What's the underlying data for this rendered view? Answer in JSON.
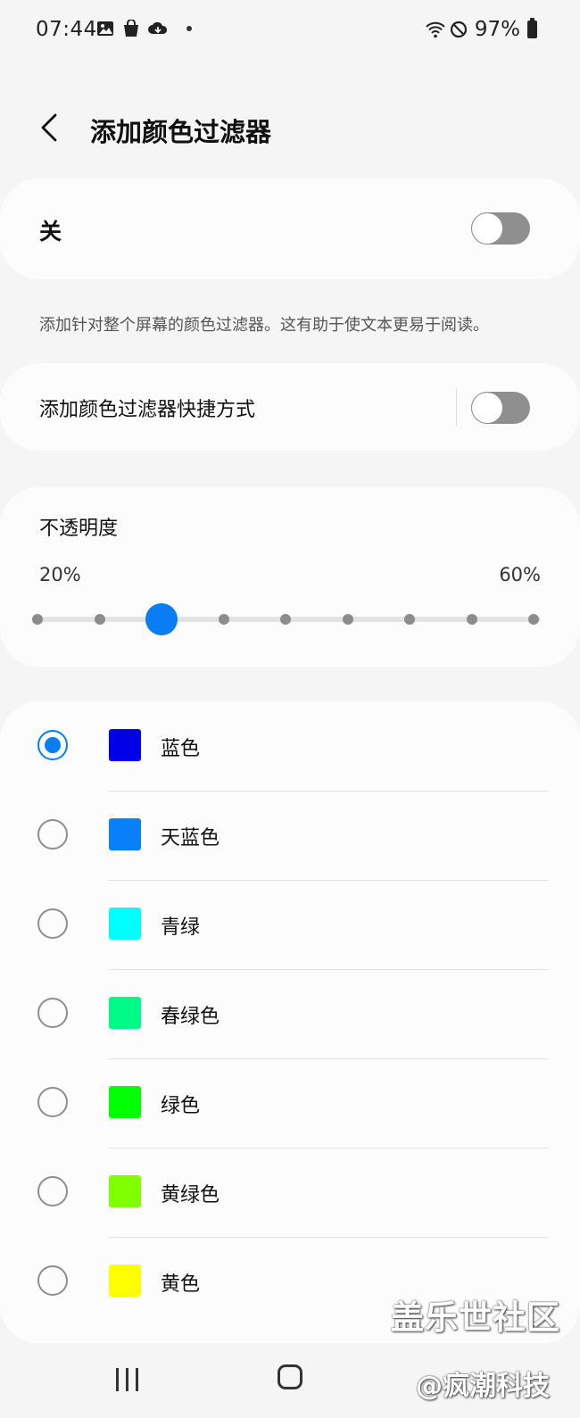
{
  "status_bar": {
    "time": "07:44",
    "battery": "97%",
    "left_icons": [
      "gallery-icon",
      "shopping-bag-icon",
      "cloud-sync-icon",
      "notification-dot"
    ],
    "right_icons": [
      "wifi-icon",
      "do-not-disturb-icon",
      "battery-icon"
    ]
  },
  "header": {
    "title": "添加颜色过滤器",
    "back_icon": "chevron-left-icon"
  },
  "master_toggle": {
    "label": "关",
    "enabled": false
  },
  "description": "添加针对整个屏幕的颜色过滤器。这有助于使文本更易于阅读。",
  "shortcut": {
    "label": "添加颜色过滤器快捷方式",
    "enabled": false
  },
  "opacity": {
    "label": "不透明度",
    "min_label": "20%",
    "max_label": "60%",
    "steps": 9,
    "selected_step": 2
  },
  "colors": [
    {
      "name": "蓝色",
      "swatch": "#0000e6",
      "selected": true
    },
    {
      "name": "天蓝色",
      "swatch": "#0a80f8",
      "selected": false
    },
    {
      "name": "青绿",
      "swatch": "#00ffff",
      "selected": false
    },
    {
      "name": "春绿色",
      "swatch": "#00fa87",
      "selected": false
    },
    {
      "name": "绿色",
      "swatch": "#00ff00",
      "selected": false
    },
    {
      "name": "黄绿色",
      "swatch": "#80ff00",
      "selected": false
    },
    {
      "name": "黄色",
      "swatch": "#ffff00",
      "selected": false
    }
  ],
  "colors_theme": {
    "accent": "#0a7df5",
    "toggle_off": "#8f8f8f"
  },
  "nav_bar": {
    "items": [
      "recents-icon",
      "home-icon"
    ]
  },
  "watermark": {
    "line1": "盖乐世社区",
    "line2": "@疯潮科技"
  }
}
